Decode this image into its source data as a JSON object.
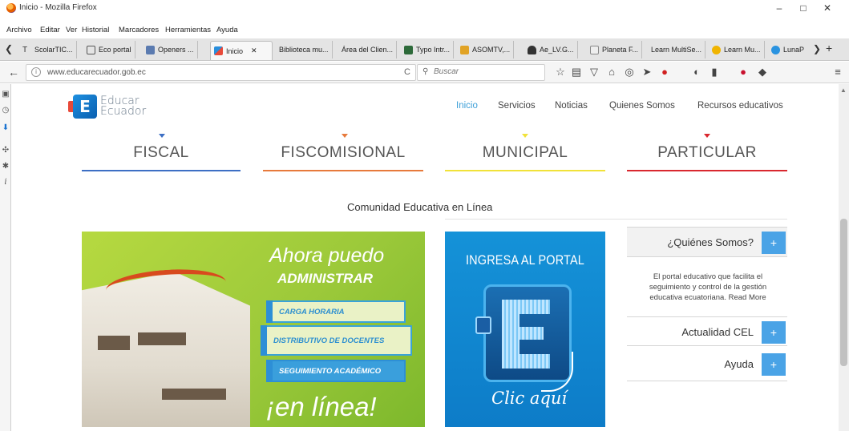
{
  "window": {
    "title": "Inicio - Mozilla Firefox",
    "minimize_glyph": "–",
    "maximize_glyph": "□",
    "close_glyph": "✕"
  },
  "menu": {
    "items": [
      "Archivo",
      "Editar",
      "Ver",
      "Historial",
      "Marcadores",
      "Herramientas",
      "Ayuda"
    ]
  },
  "tabs": {
    "items": [
      {
        "label": "ScolarTIC...",
        "icon": "scolartic-icon"
      },
      {
        "label": "Eco portal",
        "icon": "eco-portal-icon"
      },
      {
        "label": "Openers ...",
        "icon": "openers-icon"
      },
      {
        "label": "Inicio",
        "icon": "educar-ecuador-icon",
        "active": true
      },
      {
        "label": "Biblioteca mu...",
        "icon": ""
      },
      {
        "label": "Área del Clien...",
        "icon": ""
      },
      {
        "label": "Typo Intr...",
        "icon": "typo-icon"
      },
      {
        "label": "ASOMTV,...",
        "icon": "asomtv-icon"
      },
      {
        "label": "Ae_LV.G...",
        "icon": "user-icon"
      },
      {
        "label": "Planeta F...",
        "icon": "planeta-icon"
      },
      {
        "label": "Learn MultiSe...",
        "icon": ""
      },
      {
        "label": "Learn Mu...",
        "icon": "learn-icon"
      },
      {
        "label": "LunaP",
        "icon": "luna-icon"
      }
    ],
    "close_glyph": "✕",
    "new_tab_glyph": "+",
    "scroll_left_glyph": "❮",
    "scroll_right_glyph": "❯"
  },
  "nav": {
    "url": "www.educarecuador.gob.ec",
    "search_placeholder": "Buscar",
    "back_glyph": "←",
    "reload_glyph": "C"
  },
  "site": {
    "logo_letter": "E",
    "logo_line1": "Educar",
    "logo_line2": "Ecuador",
    "nav_items": [
      {
        "label": "Inicio",
        "active": true
      },
      {
        "label": "Servicios"
      },
      {
        "label": "Noticias"
      },
      {
        "label": "Quienes Somos"
      },
      {
        "label": "Recursos educativos"
      }
    ],
    "sectors": [
      {
        "label": "FISCAL",
        "color": "#3d6fc4"
      },
      {
        "label": "FISCOMISIONAL",
        "color": "#e77a3c"
      },
      {
        "label": "MUNICIPAL",
        "color": "#f1e23a"
      },
      {
        "label": "PARTICULAR",
        "color": "#d9282f"
      }
    ],
    "section_title": "Comunidad Educativa en Línea",
    "banner": {
      "headline1": "Ahora puedo",
      "headline2": "ADMINISTRAR",
      "pill1": "CARGA HORARIA",
      "pill2": "DISTRIBUTIVO DE DOCENTES",
      "pill3": "SEGUIMIENTO ACADÉMICO",
      "tagline": "¡en línea!"
    },
    "portal": {
      "title": "INGRESA AL PORTAL",
      "cta": "Clic aquí"
    },
    "accordion": [
      {
        "label": "¿Quiénes Somos?",
        "body": "El portal educativo que facilita el seguimiento y control de la gestión educativa ecuatoriana. Read More"
      },
      {
        "label": "Actualidad CEL"
      },
      {
        "label": "Ayuda"
      }
    ],
    "plus_glyph": "+"
  },
  "colors": {
    "accent": "#3ea0d8",
    "plus_button": "#4aa3e6"
  }
}
